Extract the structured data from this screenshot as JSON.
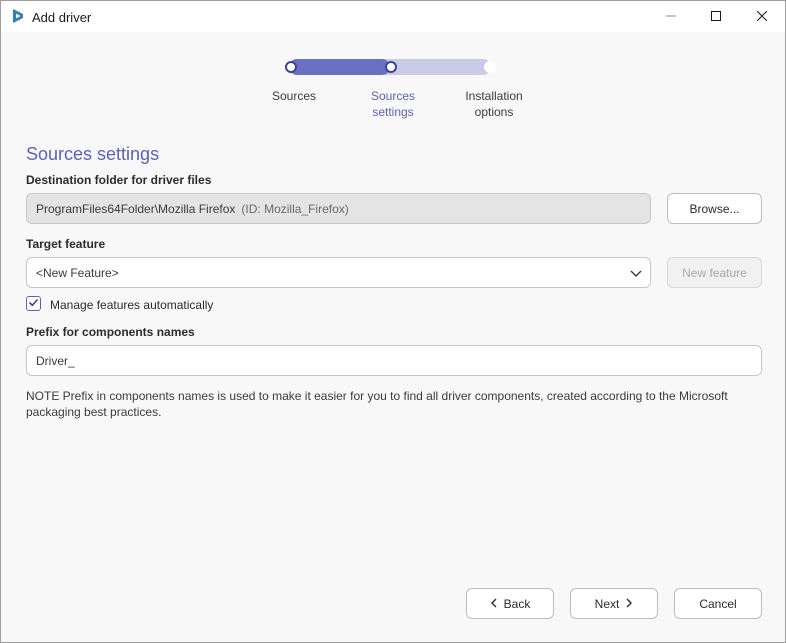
{
  "window": {
    "title": "Add driver",
    "accent_color": "#5b62b8"
  },
  "stepper": {
    "progress": 0.5,
    "steps": [
      {
        "label_line1": "Sources",
        "label_line2": "",
        "state": "done"
      },
      {
        "label_line1": "Sources",
        "label_line2": "settings",
        "state": "current"
      },
      {
        "label_line1": "Installation",
        "label_line2": "options",
        "state": "todo"
      }
    ]
  },
  "page": {
    "heading": "Sources settings"
  },
  "destination": {
    "label": "Destination folder for driver files",
    "value": "ProgramFiles64Folder\\Mozilla Firefox",
    "id_text": "(ID: Mozilla_Firefox)",
    "browse_label": "Browse..."
  },
  "feature": {
    "label": "Target feature",
    "selected": "<New Feature>",
    "new_feature_label": "New feature"
  },
  "manage": {
    "label": "Manage features automatically",
    "checked": true
  },
  "prefix": {
    "label": "Prefix for components names",
    "value": "Driver_"
  },
  "note": {
    "text": "NOTE Prefix in components names is used to make it easier for you to find all driver components, created according to the Microsoft packaging best practices."
  },
  "footer": {
    "back_label": "Back",
    "next_label": "Next",
    "cancel_label": "Cancel"
  },
  "icons": {
    "app": "app-logo-icon",
    "minimize": "minimize-icon",
    "maximize": "maximize-icon",
    "close": "close-icon",
    "dropdown": "chevron-down-icon",
    "check": "checkmark-icon",
    "back": "chevron-left-icon",
    "next": "chevron-right-icon"
  }
}
